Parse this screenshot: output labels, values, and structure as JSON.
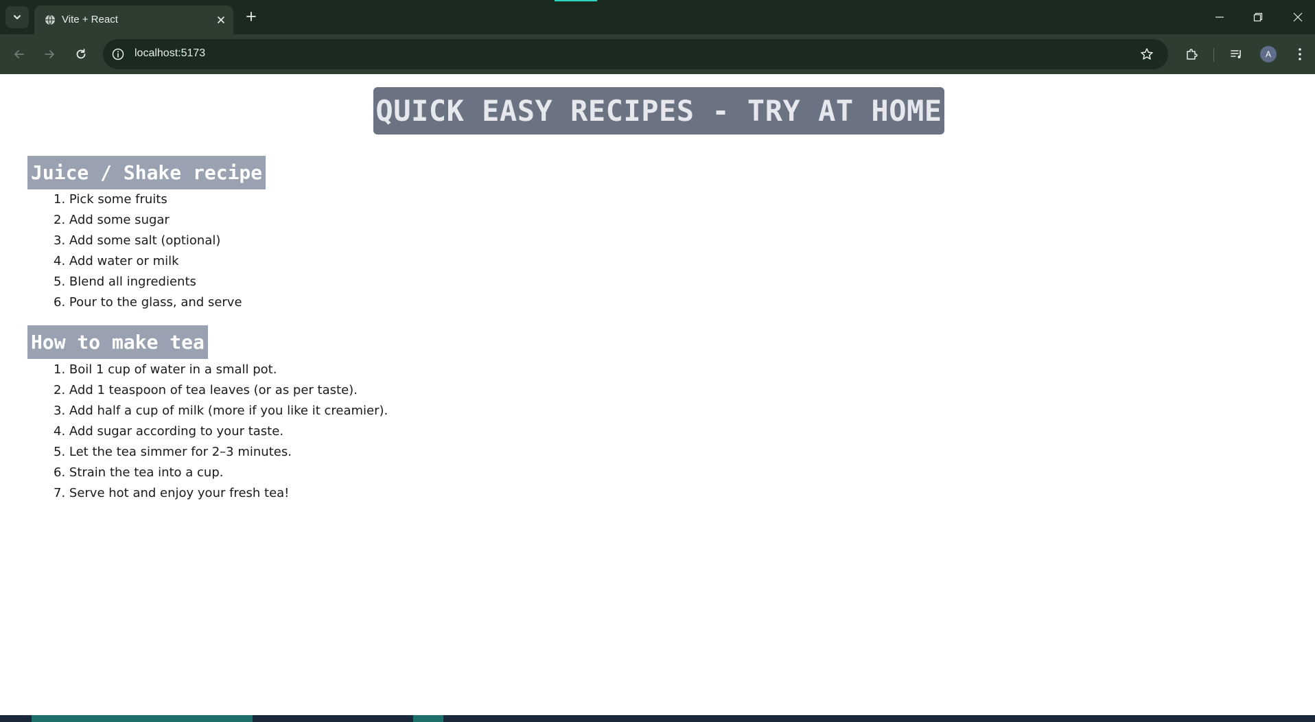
{
  "browser": {
    "tab_title": "Vite + React",
    "url": "localhost:5173",
    "avatar_initial": "A"
  },
  "page": {
    "title": "QUICK EASY RECIPES - TRY AT HOME",
    "sections": [
      {
        "heading": "Juice / Shake recipe",
        "steps": [
          "1. Pick some fruits",
          "2. Add some sugar",
          "3. Add some salt (optional)",
          "4. Add water or milk",
          "5. Blend all ingredients",
          "6. Pour to the glass, and serve"
        ]
      },
      {
        "heading": "How to make tea",
        "steps": [
          "1. Boil 1 cup of water in a small pot.",
          "2. Add 1 teaspoon of tea leaves (or as per taste).",
          "3. Add half a cup of milk (more if you like it creamier).",
          "4. Add sugar according to your taste.",
          "5. Let the tea simmer for 2–3 minutes.",
          "6. Strain the tea into a cup.",
          "7. Serve hot and enjoy your fresh tea!"
        ]
      }
    ]
  }
}
